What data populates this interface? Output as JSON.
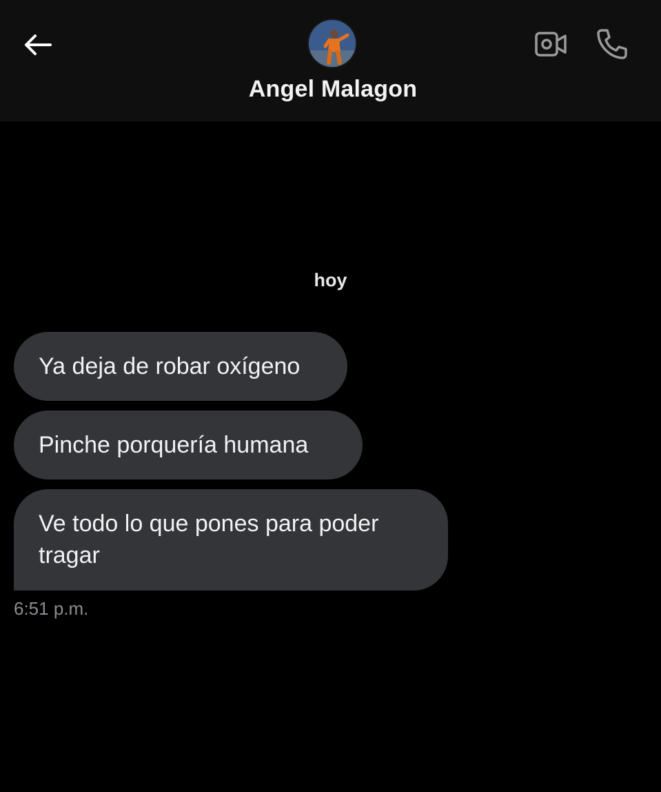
{
  "header": {
    "contact_name": "Angel Malagon",
    "avatar_description": "avatar",
    "icons": {
      "back": "arrow-left-icon",
      "video": "video-camera-icon",
      "call": "phone-icon"
    }
  },
  "conversation": {
    "date_separator": "hoy",
    "messages": [
      {
        "text": "Ya deja de robar oxígeno"
      },
      {
        "text": "Pinche porquería humana"
      },
      {
        "text": "Ve todo lo que pones para poder tragar"
      }
    ],
    "timestamp": "6:51 p.m."
  },
  "colors": {
    "background": "#000000",
    "header_background": "#0f0f0f",
    "bubble_background": "#333538",
    "timestamp_text": "#8b8d91"
  }
}
